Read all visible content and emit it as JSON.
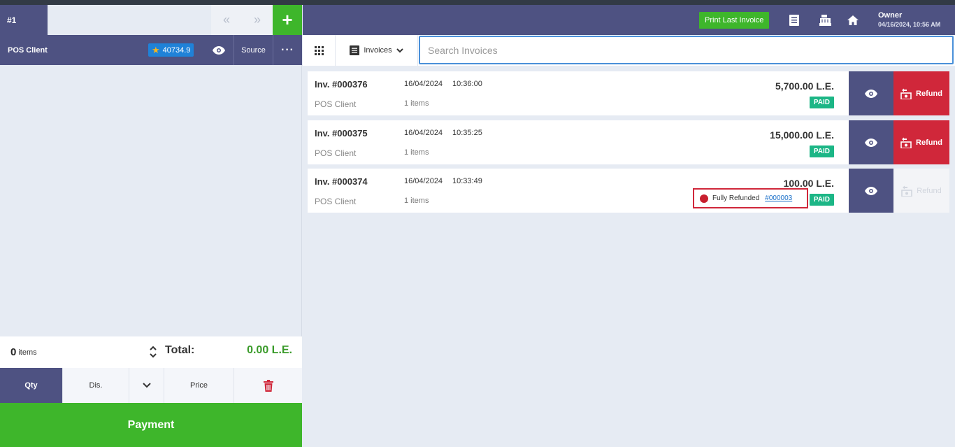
{
  "tabs": {
    "active_label": "#1",
    "prev_icon": "double-chevron-left-icon",
    "next_icon": "double-chevron-right-icon",
    "add_icon": "plus-icon"
  },
  "client": {
    "name": "POS Client",
    "points": "40734.9",
    "source_label": "Source",
    "more_label": "···"
  },
  "cart": {
    "items_count": "0",
    "items_label": "items",
    "total_label": "Total:",
    "total_value": "0.00 L.E."
  },
  "actions": {
    "qty": "Qty",
    "discount": "Dis.",
    "price": "Price"
  },
  "payment_label": "Payment",
  "header": {
    "print_label": "Print Last Invoice",
    "owner_name": "Owner",
    "owner_datetime": "04/16/2024, 10:56 AM"
  },
  "search": {
    "dropdown_label": "Invoices",
    "placeholder": "Search Invoices"
  },
  "invoices": [
    {
      "number": "Inv. #000376",
      "date": "16/04/2024",
      "time": "10:36:00",
      "client": "POS Client",
      "items": "1 items",
      "amount": "5,700.00 L.E.",
      "status": "PAID",
      "refund_label": "Refund"
    },
    {
      "number": "Inv. #000375",
      "date": "16/04/2024",
      "time": "10:35:25",
      "client": "POS Client",
      "items": "1 items",
      "amount": "15,000.00 L.E.",
      "status": "PAID",
      "refund_label": "Refund"
    },
    {
      "number": "Inv. #000374",
      "date": "16/04/2024",
      "time": "10:33:49",
      "client": "POS Client",
      "items": "1 items",
      "amount": "100.00 L.E.",
      "status": "PAID",
      "refund_label": "Refund",
      "refund_status": "Fully Refunded",
      "refund_ref": "#000003"
    }
  ],
  "colors": {
    "primary": "#4e5282",
    "success": "#3eb62b",
    "danger": "#d0273a",
    "paid": "#1cb686",
    "link": "#1a6fc8"
  }
}
